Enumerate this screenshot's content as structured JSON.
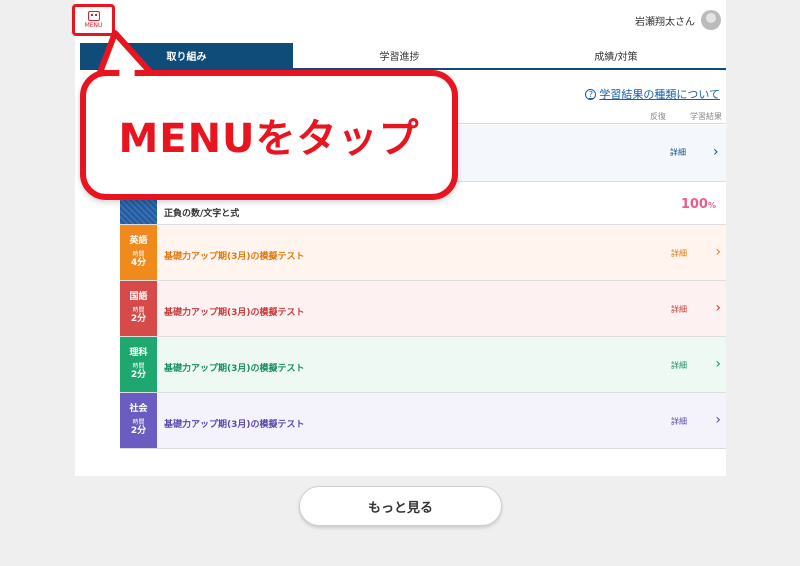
{
  "header": {
    "menu_label": "MENU",
    "user_name": "岩瀬翔太さん"
  },
  "tabs": [
    {
      "label": "取り組み",
      "active": true
    },
    {
      "label": "学習進捗",
      "active": false
    },
    {
      "label": "成績/対策",
      "active": false
    }
  ],
  "info_link": "学習結果の種類について",
  "columns": {
    "reflection": "反復",
    "result": "学習結果"
  },
  "rows": [
    {
      "subject": "",
      "time_label": "",
      "minutes": "",
      "title": "",
      "detail": "詳細"
    },
    {
      "subject": "",
      "time_label": "",
      "minutes": "",
      "title": "正負の数/文字と式",
      "score": "100",
      "score_unit": "%"
    },
    {
      "subject": "英語",
      "time_label": "時間",
      "minutes": "4分",
      "title": "基礎力アップ期(3月)の模擬テスト",
      "detail": "詳細"
    },
    {
      "subject": "国語",
      "time_label": "時間",
      "minutes": "2分",
      "title": "基礎力アップ期(3月)の模擬テスト",
      "detail": "詳細"
    },
    {
      "subject": "理科",
      "time_label": "時間",
      "minutes": "2分",
      "title": "基礎力アップ期(3月)の模擬テスト",
      "detail": "詳細"
    },
    {
      "subject": "社会",
      "time_label": "時間",
      "minutes": "2分",
      "title": "基礎力アップ期(3月)の模擬テスト",
      "detail": "詳細"
    }
  ],
  "more_button": "もっと見る",
  "callout": "MENUをタップ",
  "colors": {
    "accent": "#e8141f",
    "tab_active": "#0f4c7a",
    "english": "#f08a1c",
    "japanese": "#d64a4a",
    "science": "#1ea870",
    "social": "#6a5cc0",
    "math": "#1f5aa3"
  },
  "icons": {
    "menu": "menu-robot-icon",
    "avatar": "user-avatar-icon",
    "help": "question-circle-icon",
    "chevron": "chevron-right-icon"
  }
}
